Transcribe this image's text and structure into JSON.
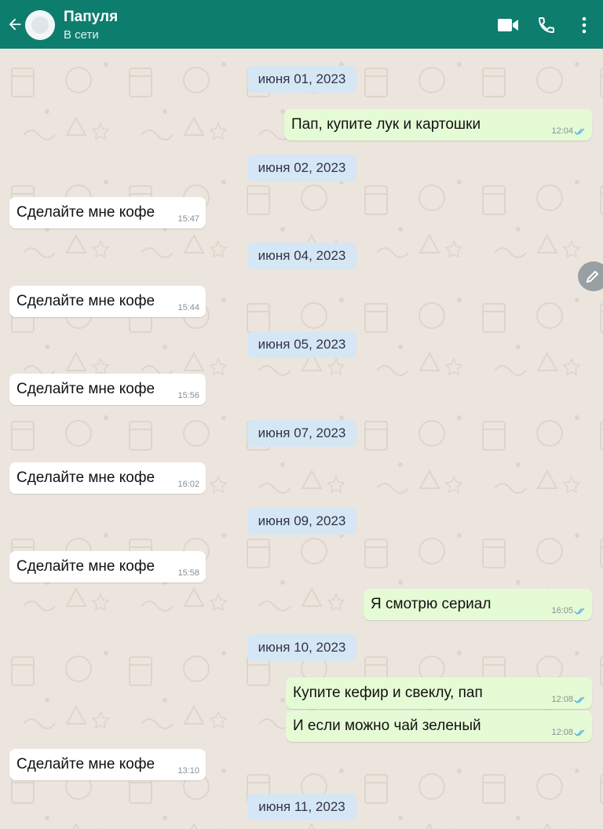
{
  "header": {
    "contact_name": "Папуля",
    "status": "В сети",
    "icons": [
      "back-arrow-icon",
      "avatar",
      "video-camera-icon",
      "phone-icon",
      "more-vert-icon"
    ]
  },
  "colors": {
    "header": "#0d7d6e",
    "chat_bg": "#ece5dd",
    "incoming_bubble": "#ffffff",
    "outgoing_bubble": "#e5fbd5",
    "date_chip": "#d5e6f4",
    "read_ticks": "#4fb0e8"
  },
  "chat": {
    "dates": [
      "июня 01, 2023",
      "июня 02, 2023",
      "июня 04, 2023",
      "июня 05, 2023",
      "июня 07, 2023",
      "июня 09, 2023",
      "июня 10, 2023",
      "июня 11, 2023"
    ],
    "messages": [
      {
        "text": "Пап, купите лук и картошки",
        "time": "12:04",
        "direction": "out",
        "status": "read"
      },
      {
        "text": "Сделайте мне кофе",
        "time": "15:47",
        "direction": "in"
      },
      {
        "text": "Сделайте мне кофе",
        "time": "15:44",
        "direction": "in"
      },
      {
        "text": "Сделайте мне кофе",
        "time": "15:56",
        "direction": "in"
      },
      {
        "text": "Сделайте мне кофе",
        "time": "16:02",
        "direction": "in"
      },
      {
        "text": "Сделайте мне кофе",
        "time": "15:58",
        "direction": "in"
      },
      {
        "text": "Я смотрю сериал",
        "time": "16:05",
        "direction": "out",
        "status": "read"
      },
      {
        "text": "Купите кефир и свеклу, пап",
        "time": "12:08",
        "direction": "out",
        "status": "read"
      },
      {
        "text": "И если можно чай зеленый",
        "time": "12:08",
        "direction": "out",
        "status": "read"
      },
      {
        "text": "Сделайте мне кофе",
        "time": "13:10",
        "direction": "in"
      }
    ]
  }
}
